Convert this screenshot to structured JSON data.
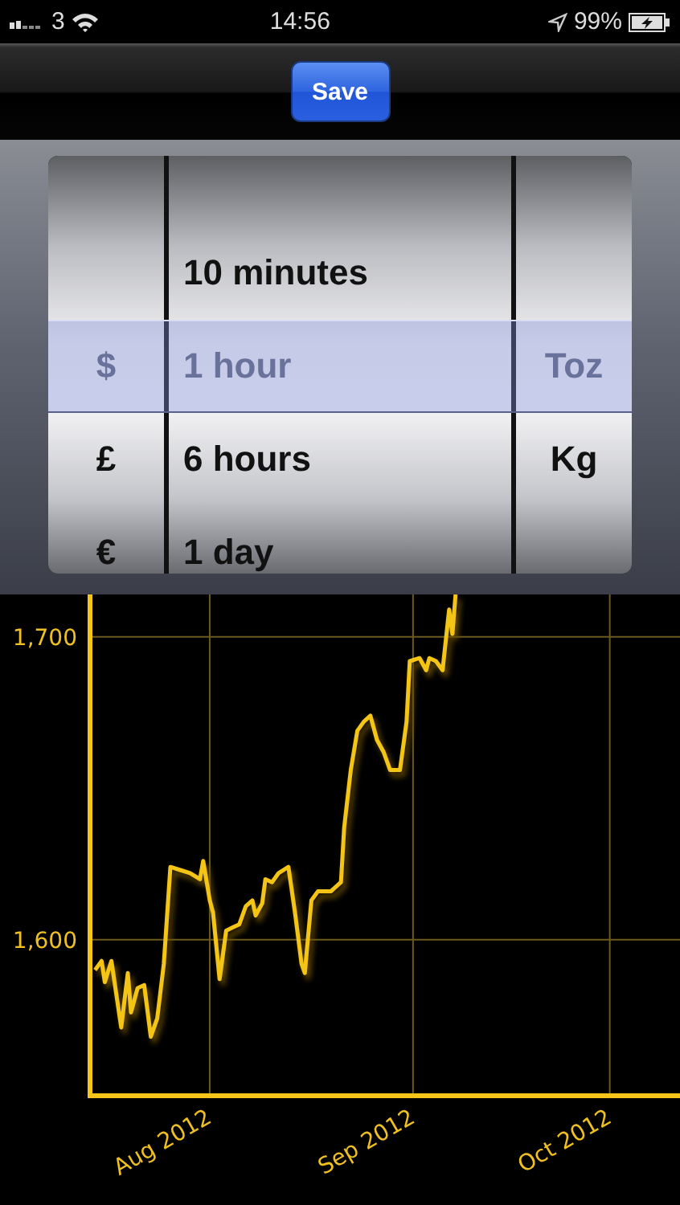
{
  "status_bar": {
    "carrier": "3",
    "time": "14:56",
    "battery": "99%"
  },
  "toolbar": {
    "save_button": "Save"
  },
  "picker": {
    "columns": [
      {
        "kind": "currency",
        "items": [
          {
            "label": "$",
            "selected": true
          },
          {
            "label": "£",
            "selected": false
          },
          {
            "label": "€",
            "selected": false
          }
        ]
      },
      {
        "kind": "interval",
        "items": [
          {
            "label": "10 minutes",
            "selected": false
          },
          {
            "label": "1 hour",
            "selected": true
          },
          {
            "label": "6 hours",
            "selected": false
          },
          {
            "label": "1 day",
            "selected": false
          }
        ]
      },
      {
        "kind": "unit",
        "items": [
          {
            "label": "Toz",
            "selected": true
          },
          {
            "label": "Kg",
            "selected": false
          }
        ]
      }
    ]
  },
  "chart": {
    "chart_data": {
      "type": "line",
      "grid": true,
      "xlim": [
        "2012-07-13T12:00",
        "2012-10-11T17:00"
      ],
      "ylim": [
        1549,
        1714
      ],
      "yticks": [
        {
          "value": 1600,
          "label": "1,600"
        },
        {
          "value": 1700,
          "label": "1,700"
        }
      ],
      "xticks": [
        {
          "value": "2012-08-01T00:00",
          "label": "Aug 2012"
        },
        {
          "value": "2012-09-01T00:00",
          "label": "Sep 2012"
        },
        {
          "value": "2012-10-01T00:00",
          "label": "Oct 2012"
        }
      ],
      "x": [
        "2012-07-14T12:00",
        "2012-07-15T12:00",
        "2012-07-16T00:00",
        "2012-07-17T00:00",
        "2012-07-18T12:00",
        "2012-07-19T12:00",
        "2012-07-20T00:00",
        "2012-07-21T00:00",
        "2012-07-22T00:00",
        "2012-07-23T00:00",
        "2012-07-24T00:00",
        "2012-07-25T00:00",
        "2012-07-26T00:00",
        "2012-07-27T12:00",
        "2012-07-29T00:00",
        "2012-07-30T12:00",
        "2012-07-31T00:00",
        "2012-08-01T00:00",
        "2012-08-01T12:00",
        "2012-08-02T12:00",
        "2012-08-03T12:00",
        "2012-08-04T12:00",
        "2012-08-05T12:00",
        "2012-08-06T12:00",
        "2012-08-07T12:00",
        "2012-08-08T00:00",
        "2012-08-09T00:00",
        "2012-08-09T12:00",
        "2012-08-10T12:00",
        "2012-08-11T12:00",
        "2012-08-13T00:00",
        "2012-08-14T00:00",
        "2012-08-15T00:00",
        "2012-08-15T12:00",
        "2012-08-16T12:00",
        "2012-08-17T12:00",
        "2012-08-19T12:00",
        "2012-08-21T00:00",
        "2012-08-21T12:00",
        "2012-08-22T12:00",
        "2012-08-23T12:00",
        "2012-08-24T12:00",
        "2012-08-25T12:00",
        "2012-08-26T12:00",
        "2012-08-27T12:00",
        "2012-08-28T12:00",
        "2012-08-30T00:00",
        "2012-08-31T00:00",
        "2012-08-31T12:00",
        "2012-09-02T00:00",
        "2012-09-03T00:00",
        "2012-09-03T12:00",
        "2012-09-04T12:00",
        "2012-09-05T12:00",
        "2012-09-06T12:00",
        "2012-09-07T00:00",
        "2012-09-07T12:00"
      ],
      "series": [
        {
          "color": "#f5c518",
          "values": [
            1590,
            1593,
            1586,
            1593,
            1571,
            1589,
            1576,
            1584,
            1585,
            1568,
            1574,
            1592,
            1624,
            1623,
            1622,
            1620,
            1626,
            1613,
            1609,
            1587,
            1603,
            1604,
            1605,
            1611,
            1613,
            1608,
            1612,
            1620,
            1619,
            1622,
            1624,
            1609,
            1592,
            1589,
            1613,
            1616,
            1616,
            1619,
            1637,
            1656,
            1669,
            1672,
            1674,
            1666,
            1662,
            1656,
            1656,
            1672,
            1692,
            1693,
            1689,
            1693,
            1692,
            1689,
            1709,
            1701,
            1714
          ]
        }
      ]
    }
  }
}
